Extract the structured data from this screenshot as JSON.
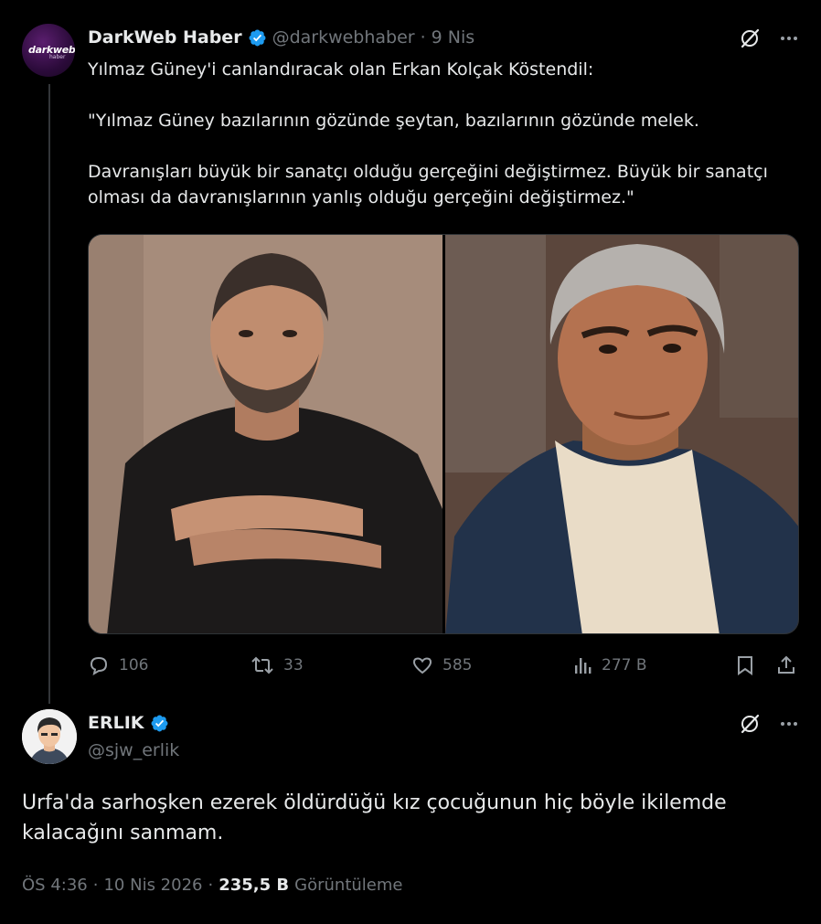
{
  "quoted_tweet": {
    "author_name": "DarkWeb Haber",
    "handle": "@darkwebhaber",
    "separator": "·",
    "date": "9 Nis",
    "avatar_logo_text": "darkweb",
    "avatar_logo_sub": "haber",
    "text_lines": [
      "Yılmaz Güney'i canlandıracak olan Erkan Kolçak Köstendil:",
      "\"Yılmaz Güney bazılarının gözünde şeytan, bazılarının gözünde melek.",
      "Davranışları büyük bir sanatçı olduğu gerçeğini değiştirmez. Büyük bir sanatçı olması da davranışlarının yanlış olduğu gerçeğini değiştirmez.\""
    ],
    "actions": {
      "replies": "106",
      "reposts": "33",
      "likes": "585",
      "views": "277 B"
    }
  },
  "main_tweet": {
    "author_name": "ERLIK",
    "handle": "@sjw_erlik",
    "text": "Urfa'da sarhoşken ezerek öldürdüğü kız çocuğunun hiç böyle ikilemde kalacağını sanmam.",
    "time": "ÖS 4:36",
    "separator1": "·",
    "date": "10 Nis 2026",
    "separator2": "·",
    "views_count": "235,5 B",
    "views_label": "Görüntüleme"
  },
  "colors": {
    "background": "#000000",
    "text_primary": "#e7e9ea",
    "text_secondary": "#71767b",
    "verified_blue": "#1d9bf0",
    "divider": "#2f3336"
  },
  "icons": [
    "verified-badge-icon",
    "grok-icon",
    "more-icon",
    "reply-icon",
    "repost-icon",
    "like-icon",
    "views-icon",
    "bookmark-icon",
    "share-icon"
  ]
}
